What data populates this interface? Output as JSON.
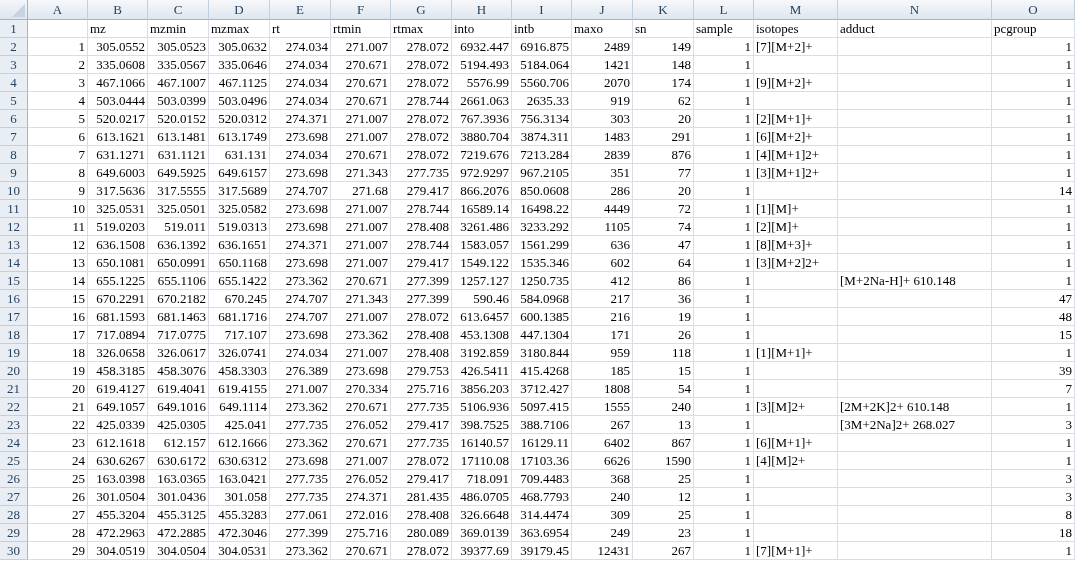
{
  "columns": [
    {
      "letter": "A",
      "kind": "number"
    },
    {
      "letter": "B",
      "kind": "number"
    },
    {
      "letter": "C",
      "kind": "number"
    },
    {
      "letter": "D",
      "kind": "number"
    },
    {
      "letter": "E",
      "kind": "number"
    },
    {
      "letter": "F",
      "kind": "number"
    },
    {
      "letter": "G",
      "kind": "number"
    },
    {
      "letter": "H",
      "kind": "number"
    },
    {
      "letter": "I",
      "kind": "number"
    },
    {
      "letter": "J",
      "kind": "number"
    },
    {
      "letter": "K",
      "kind": "number"
    },
    {
      "letter": "L",
      "kind": "number"
    },
    {
      "letter": "M",
      "kind": "text"
    },
    {
      "letter": "N",
      "kind": "text"
    },
    {
      "letter": "O",
      "kind": "number"
    }
  ],
  "header_row": {
    "number": "1",
    "cells": [
      null,
      "mz",
      "mzmin",
      "mzmax",
      "rt",
      "rtmin",
      "rtmax",
      "into",
      "intb",
      "maxo",
      "sn",
      "sample",
      "isotopes",
      "adduct",
      "pcgroup"
    ]
  },
  "rows": [
    {
      "number": "2",
      "cells": [
        "1",
        "305.0552",
        "305.0523",
        "305.0632",
        "274.034",
        "271.007",
        "278.072",
        "6932.447",
        "6916.875",
        "2489",
        "149",
        "1",
        "[7][M+2]+",
        null,
        "1"
      ]
    },
    {
      "number": "3",
      "cells": [
        "2",
        "335.0608",
        "335.0567",
        "335.0646",
        "274.034",
        "270.671",
        "278.072",
        "5194.493",
        "5184.064",
        "1421",
        "148",
        "1",
        null,
        null,
        "1"
      ]
    },
    {
      "number": "4",
      "cells": [
        "3",
        "467.1066",
        "467.1007",
        "467.1125",
        "274.034",
        "270.671",
        "278.072",
        "5576.99",
        "5560.706",
        "2070",
        "174",
        "1",
        "[9][M+2]+",
        null,
        "1"
      ]
    },
    {
      "number": "5",
      "cells": [
        "4",
        "503.0444",
        "503.0399",
        "503.0496",
        "274.034",
        "270.671",
        "278.744",
        "2661.063",
        "2635.33",
        "919",
        "62",
        "1",
        null,
        null,
        "1"
      ]
    },
    {
      "number": "6",
      "cells": [
        "5",
        "520.0217",
        "520.0152",
        "520.0312",
        "274.371",
        "271.007",
        "278.072",
        "767.3936",
        "756.3134",
        "303",
        "20",
        "1",
        "[2][M+1]+",
        null,
        "1"
      ]
    },
    {
      "number": "7",
      "cells": [
        "6",
        "613.1621",
        "613.1481",
        "613.1749",
        "273.698",
        "271.007",
        "278.072",
        "3880.704",
        "3874.311",
        "1483",
        "291",
        "1",
        "[6][M+2]+",
        null,
        "1"
      ]
    },
    {
      "number": "8",
      "cells": [
        "7",
        "631.1271",
        "631.1121",
        "631.131",
        "274.034",
        "270.671",
        "278.072",
        "7219.676",
        "7213.284",
        "2839",
        "876",
        "1",
        "[4][M+1]2+",
        null,
        "1"
      ]
    },
    {
      "number": "9",
      "cells": [
        "8",
        "649.6003",
        "649.5925",
        "649.6157",
        "273.698",
        "271.343",
        "277.735",
        "972.9297",
        "967.2105",
        "351",
        "77",
        "1",
        "[3][M+1]2+",
        null,
        "1"
      ]
    },
    {
      "number": "10",
      "cells": [
        "9",
        "317.5636",
        "317.5555",
        "317.5689",
        "274.707",
        "271.68",
        "279.417",
        "866.2076",
        "850.0608",
        "286",
        "20",
        "1",
        null,
        null,
        "14"
      ]
    },
    {
      "number": "11",
      "cells": [
        "10",
        "325.0531",
        "325.0501",
        "325.0582",
        "273.698",
        "271.007",
        "278.744",
        "16589.14",
        "16498.22",
        "4449",
        "72",
        "1",
        "[1][M]+",
        null,
        "1"
      ]
    },
    {
      "number": "12",
      "cells": [
        "11",
        "519.0203",
        "519.011",
        "519.0313",
        "273.698",
        "271.007",
        "278.408",
        "3261.486",
        "3233.292",
        "1105",
        "74",
        "1",
        "[2][M]+",
        null,
        "1"
      ]
    },
    {
      "number": "13",
      "cells": [
        "12",
        "636.1508",
        "636.1392",
        "636.1651",
        "274.371",
        "271.007",
        "278.744",
        "1583.057",
        "1561.299",
        "636",
        "47",
        "1",
        "[8][M+3]+",
        null,
        "1"
      ]
    },
    {
      "number": "14",
      "cells": [
        "13",
        "650.1081",
        "650.0991",
        "650.1168",
        "273.698",
        "271.007",
        "279.417",
        "1549.122",
        "1535.346",
        "602",
        "64",
        "1",
        "[3][M+2]2+",
        null,
        "1"
      ]
    },
    {
      "number": "15",
      "cells": [
        "14",
        "655.1225",
        "655.1106",
        "655.1422",
        "273.362",
        "270.671",
        "277.399",
        "1257.127",
        "1250.735",
        "412",
        "86",
        "1",
        null,
        "[M+2Na-H]+ 610.148",
        "1"
      ]
    },
    {
      "number": "16",
      "cells": [
        "15",
        "670.2291",
        "670.2182",
        "670.245",
        "274.707",
        "271.343",
        "277.399",
        "590.46",
        "584.0968",
        "217",
        "36",
        "1",
        null,
        null,
        "47"
      ]
    },
    {
      "number": "17",
      "cells": [
        "16",
        "681.1593",
        "681.1463",
        "681.1716",
        "274.707",
        "271.007",
        "278.072",
        "613.6457",
        "600.1385",
        "216",
        "19",
        "1",
        null,
        null,
        "48"
      ]
    },
    {
      "number": "18",
      "cells": [
        "17",
        "717.0894",
        "717.0775",
        "717.107",
        "273.698",
        "273.362",
        "278.408",
        "453.1308",
        "447.1304",
        "171",
        "26",
        "1",
        null,
        null,
        "15"
      ]
    },
    {
      "number": "19",
      "cells": [
        "18",
        "326.0658",
        "326.0617",
        "326.0741",
        "274.034",
        "271.007",
        "278.408",
        "3192.859",
        "3180.844",
        "959",
        "118",
        "1",
        "[1][M+1]+",
        null,
        "1"
      ]
    },
    {
      "number": "20",
      "cells": [
        "19",
        "458.3185",
        "458.3076",
        "458.3303",
        "276.389",
        "273.698",
        "279.753",
        "426.5411",
        "415.4268",
        "185",
        "15",
        "1",
        null,
        null,
        "39"
      ]
    },
    {
      "number": "21",
      "cells": [
        "20",
        "619.4127",
        "619.4041",
        "619.4155",
        "271.007",
        "270.334",
        "275.716",
        "3856.203",
        "3712.427",
        "1808",
        "54",
        "1",
        null,
        null,
        "7"
      ]
    },
    {
      "number": "22",
      "cells": [
        "21",
        "649.1057",
        "649.1016",
        "649.1114",
        "273.362",
        "270.671",
        "277.735",
        "5106.936",
        "5097.415",
        "1555",
        "240",
        "1",
        "[3][M]2+",
        "[2M+2K]2+ 610.148",
        "1"
      ]
    },
    {
      "number": "23",
      "cells": [
        "22",
        "425.0339",
        "425.0305",
        "425.041",
        "277.735",
        "276.052",
        "279.417",
        "398.7525",
        "388.7106",
        "267",
        "13",
        "1",
        null,
        "[3M+2Na]2+ 268.027",
        "3"
      ]
    },
    {
      "number": "24",
      "cells": [
        "23",
        "612.1618",
        "612.157",
        "612.1666",
        "273.362",
        "270.671",
        "277.735",
        "16140.57",
        "16129.11",
        "6402",
        "867",
        "1",
        "[6][M+1]+",
        null,
        "1"
      ]
    },
    {
      "number": "25",
      "cells": [
        "24",
        "630.6267",
        "630.6172",
        "630.6312",
        "273.698",
        "271.007",
        "278.072",
        "17110.08",
        "17103.36",
        "6626",
        "1590",
        "1",
        "[4][M]2+",
        null,
        "1"
      ]
    },
    {
      "number": "26",
      "cells": [
        "25",
        "163.0398",
        "163.0365",
        "163.0421",
        "277.735",
        "276.052",
        "279.417",
        "718.091",
        "709.4483",
        "368",
        "25",
        "1",
        null,
        null,
        "3"
      ]
    },
    {
      "number": "27",
      "cells": [
        "26",
        "301.0504",
        "301.0436",
        "301.058",
        "277.735",
        "274.371",
        "281.435",
        "486.0705",
        "468.7793",
        "240",
        "12",
        "1",
        null,
        null,
        "3"
      ]
    },
    {
      "number": "28",
      "cells": [
        "27",
        "455.3204",
        "455.3125",
        "455.3283",
        "277.061",
        "272.016",
        "278.408",
        "326.6648",
        "314.4474",
        "309",
        "25",
        "1",
        null,
        null,
        "8"
      ]
    },
    {
      "number": "29",
      "cells": [
        "28",
        "472.2963",
        "472.2885",
        "472.3046",
        "277.399",
        "275.716",
        "280.089",
        "369.0139",
        "363.6954",
        "249",
        "23",
        "1",
        null,
        null,
        "18"
      ]
    },
    {
      "number": "30",
      "cells": [
        "29",
        "304.0519",
        "304.0504",
        "304.0531",
        "273.362",
        "270.671",
        "278.072",
        "39377.69",
        "39179.45",
        "12431",
        "267",
        "1",
        "[7][M+1]+",
        null,
        "1"
      ]
    }
  ]
}
